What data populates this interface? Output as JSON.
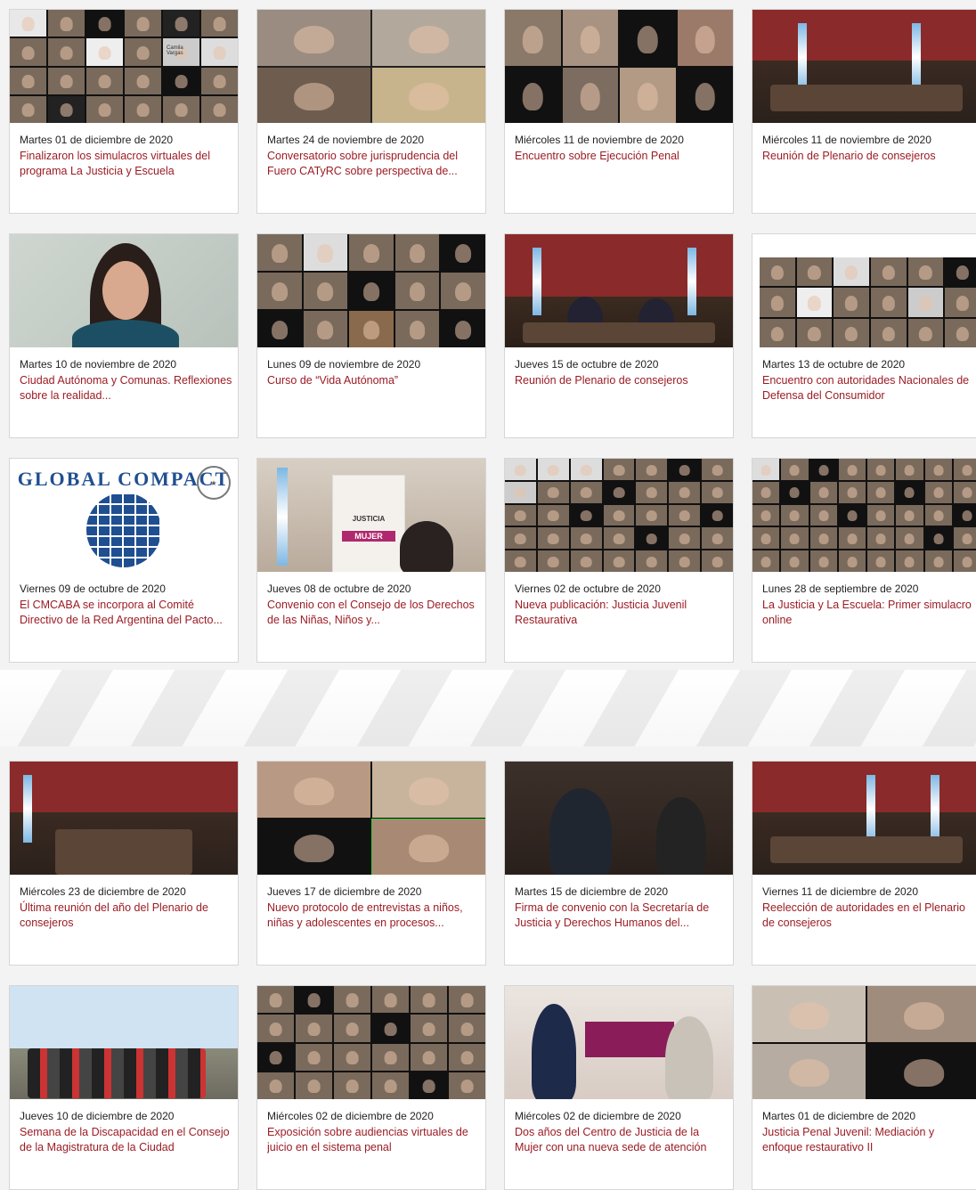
{
  "section1": {
    "cards": [
      {
        "date": "Martes 01 de diciembre de 2020",
        "title": "Finalizaron los simulacros virtuales del programa La Justicia y Escuela",
        "thumb_text": "Camila Vargas"
      },
      {
        "date": "Martes 24 de noviembre de 2020",
        "title": "Conversatorio sobre jurisprudencia del Fuero CATyRC sobre perspectiva de..."
      },
      {
        "date": "Miércoles 11 de noviembre de 2020",
        "title": "Encuentro sobre Ejecución Penal"
      },
      {
        "date": "Miércoles 11 de noviembre de 2020",
        "title": "Reunión de Plenario de consejeros"
      },
      {
        "date": "Martes 10 de noviembre de 2020",
        "title": "Ciudad Autónoma y Comunas. Reflexiones sobre la realidad..."
      },
      {
        "date": "Lunes 09 de noviembre de 2020",
        "title": "Curso de “Vida Autónoma”"
      },
      {
        "date": "Jueves 15 de octubre de 2020",
        "title": "Reunión de Plenario de consejeros"
      },
      {
        "date": "Martes 13 de octubre de 2020",
        "title": "Encuentro con autoridades Nacionales de Defensa del Consumidor"
      },
      {
        "date": "Viernes 09 de octubre de 2020",
        "title": "El CMCABA se incorpora al Comité Directivo de la Red Argentina del Pacto...",
        "logo_text": "GLOBAL COMPACT"
      },
      {
        "date": "Jueves 08 de octubre de 2020",
        "title": "Convenio con el Consejo de los Derechos de las Niñas, Niños y...",
        "banner_text": "JUSTICIA",
        "banner_badge": "MUJER"
      },
      {
        "date": "Viernes 02 de octubre de 2020",
        "title": "Nueva publicación: Justicia Juvenil Restaurativa"
      },
      {
        "date": "Lunes 28 de septiembre de 2020",
        "title": "La Justicia y La Escuela: Primer simulacro online"
      }
    ]
  },
  "section2": {
    "cards": [
      {
        "date": "Miércoles 23 de diciembre de 2020",
        "title": "Última reunión del año del Plenario de consejeros"
      },
      {
        "date": "Jueves 17 de diciembre de 2020",
        "title": "Nuevo protocolo de entrevistas a niños, niñas y adolescentes en procesos..."
      },
      {
        "date": "Martes 15 de diciembre de 2020",
        "title": "Firma de convenio con la Secretaría de Justicia y Derechos Humanos del..."
      },
      {
        "date": "Viernes 11 de diciembre de 2020",
        "title": "Reelección de autoridades en el Plenario de consejeros"
      },
      {
        "date": "Jueves 10 de diciembre de 2020",
        "title": "Semana de la Discapacidad en el Consejo de la Magistratura de la Ciudad"
      },
      {
        "date": "Miércoles 02 de diciembre de 2020",
        "title": "Exposición sobre audiencias virtuales de juicio en el sistema penal"
      },
      {
        "date": "Miércoles 02 de diciembre de 2020",
        "title": "Dos años del Centro de Justicia de la Mujer con una nueva sede de atención"
      },
      {
        "date": "Martes 01 de diciembre de 2020",
        "title": "Justicia Penal Juvenil: Mediación y enfoque restaurativo II"
      }
    ]
  },
  "colors": {
    "title_red": "#9b1c24",
    "date_text": "#222222",
    "card_border": "#d6d6d6",
    "section_bg": "#f3f3f3"
  },
  "icons": [
    "global-compact-logo",
    "institution-seal"
  ]
}
